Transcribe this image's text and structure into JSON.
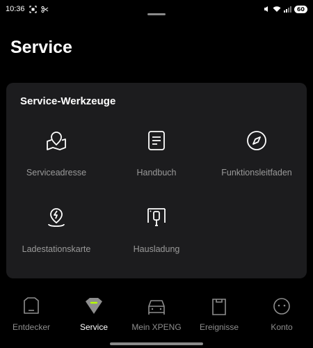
{
  "status_bar": {
    "time": "10:36",
    "battery": "60",
    "icons": [
      "screenshot-icon",
      "scissors-icon",
      "wifi-icon",
      "signal-icon",
      "battery-icon"
    ]
  },
  "page": {
    "title": "Service"
  },
  "tools_card": {
    "title": "Service-Werkzeuge",
    "items": [
      {
        "label": "Serviceadresse",
        "icon": "map-pin-icon"
      },
      {
        "label": "Handbuch",
        "icon": "manual-icon"
      },
      {
        "label": "Funktionsleitfaden",
        "icon": "compass-icon"
      },
      {
        "label": "Ladestationskarte",
        "icon": "charging-location-icon"
      },
      {
        "label": "Hausladung",
        "icon": "home-charger-icon"
      }
    ]
  },
  "bottom_nav": {
    "items": [
      {
        "label": "Entdecker",
        "icon": "discover-icon",
        "active": false
      },
      {
        "label": "Service",
        "icon": "service-icon",
        "active": true
      },
      {
        "label": "Mein XPENG",
        "icon": "car-icon",
        "active": false
      },
      {
        "label": "Ereignisse",
        "icon": "events-icon",
        "active": false
      },
      {
        "label": "Konto",
        "icon": "account-icon",
        "active": false
      }
    ]
  },
  "colors": {
    "background": "#000000",
    "card": "#1c1c1e",
    "accent": "#b7ff00",
    "muted_text": "#9a9a9a"
  }
}
